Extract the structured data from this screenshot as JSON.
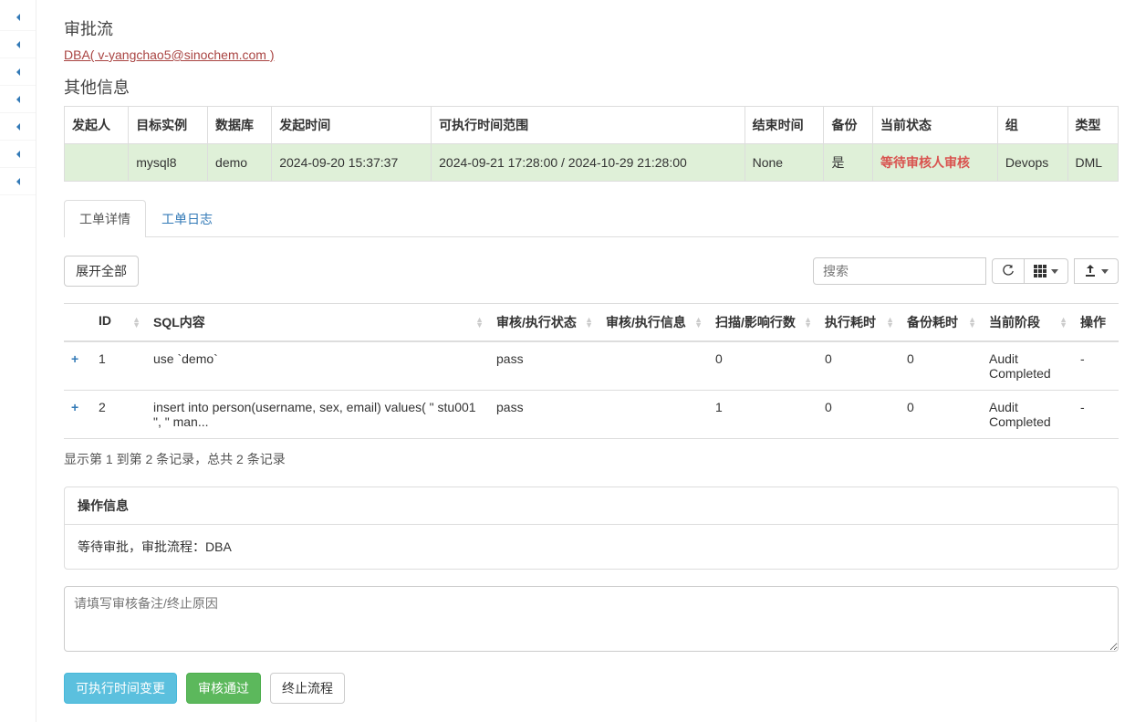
{
  "headings": {
    "approval_flow": "审批流",
    "other_info": "其他信息"
  },
  "dba_link": "DBA( v-yangchao5@sinochem.com )",
  "info_table": {
    "headers": {
      "initiator": "发起人",
      "target_instance": "目标实例",
      "database": "数据库",
      "initiate_time": "发起时间",
      "exec_time_range": "可执行时间范围",
      "end_time": "结束时间",
      "backup": "备份",
      "current_status": "当前状态",
      "group": "组",
      "type": "类型"
    },
    "row": {
      "initiator": "",
      "target_instance": "mysql8",
      "database": "demo",
      "initiate_time": "2024-09-20 15:37:37",
      "exec_time_range": "2024-09-21 17:28:00 / 2024-10-29 21:28:00",
      "end_time": "None",
      "backup": "是",
      "current_status": "等待审核人审核",
      "group": "Devops",
      "type": "DML"
    }
  },
  "tabs": {
    "detail": "工单详情",
    "log": "工单日志"
  },
  "toolbar": {
    "expand_all": "展开全部",
    "search_placeholder": "搜索"
  },
  "data_table": {
    "headers": {
      "id": "ID",
      "sql": "SQL内容",
      "review_status": "审核/执行状态",
      "review_info": "审核/执行信息",
      "affected_rows": "扫描/影响行数",
      "exec_time": "执行耗时",
      "backup_time": "备份耗时",
      "stage": "当前阶段",
      "action": "操作"
    },
    "rows": [
      {
        "id": "1",
        "sql": "use `demo`",
        "review_status": "pass",
        "review_info": "",
        "affected_rows": "0",
        "exec_time": "0",
        "backup_time": "0",
        "stage": "Audit Completed",
        "action": "-"
      },
      {
        "id": "2",
        "sql": "insert into person(username, sex, email) values( \" stu001 \", \" man...",
        "review_status": "pass",
        "review_info": "",
        "affected_rows": "1",
        "exec_time": "0",
        "backup_time": "0",
        "stage": "Audit Completed",
        "action": "-"
      }
    ]
  },
  "records_info": "显示第 1 到第 2 条记录，总共 2 条记录",
  "op_panel": {
    "title": "操作信息",
    "body": "等待审批，审批流程：DBA"
  },
  "remark_placeholder": "请填写审核备注/终止原因",
  "actions": {
    "change_time": "可执行时间变更",
    "approve": "审核通过",
    "terminate": "终止流程"
  }
}
